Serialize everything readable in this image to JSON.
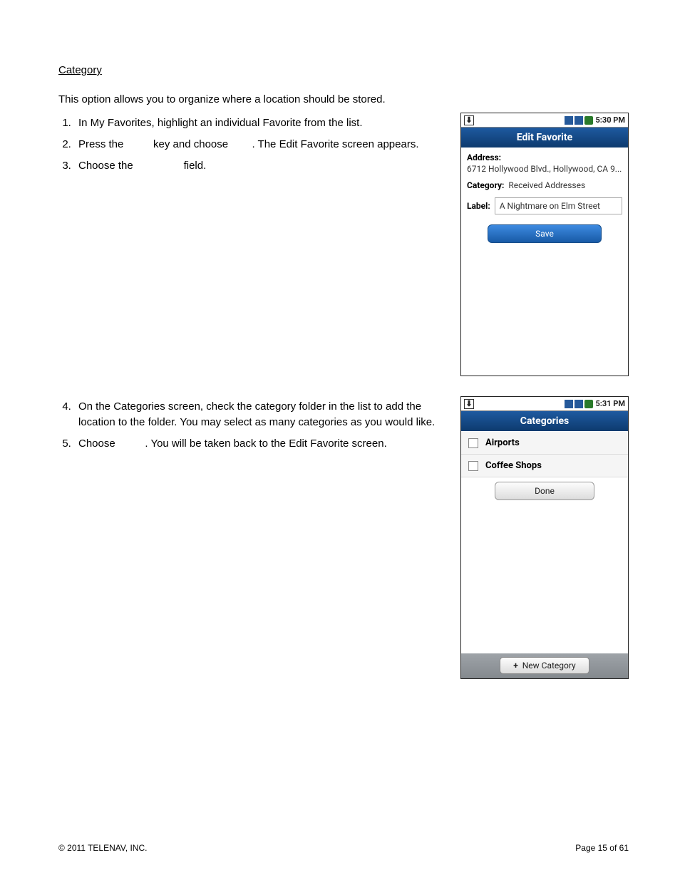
{
  "heading": "Category",
  "intro": "This option allows you to organize where a location should be stored.",
  "steps_a": {
    "s1": "In My Favorites, highlight an individual Favorite from the list.",
    "s2_a": "Press the ",
    "s2_b": " key and choose ",
    "s2_c": ". The Edit Favorite screen appears.",
    "s3_a": "Choose the ",
    "s3_b": " field."
  },
  "steps_b": {
    "s4": "On the Categories screen, check the category folder in the list to add the location to the folder. You may select as many categories as you would like.",
    "s5_a": "Choose ",
    "s5_b": ". You will be taken back to the Edit Favorite screen."
  },
  "phone1": {
    "time": "5:30 PM",
    "title": "Edit Favorite",
    "address_label": "Address:",
    "address_value": "6712 Hollywood Blvd., Hollywood, CA 9...",
    "category_label": "Category:",
    "category_value": "Received Addresses",
    "label_label": "Label:",
    "label_value": "A Nightmare on Elm Street",
    "save": "Save"
  },
  "phone2": {
    "time": "5:31 PM",
    "title": "Categories",
    "items": {
      "i0": "Airports",
      "i1": "Coffee Shops"
    },
    "done": "Done",
    "new_cat": "New Category"
  },
  "footer": {
    "copyright": "© 2011 TELENAV, INC.",
    "page": "Page 15 of 61"
  }
}
